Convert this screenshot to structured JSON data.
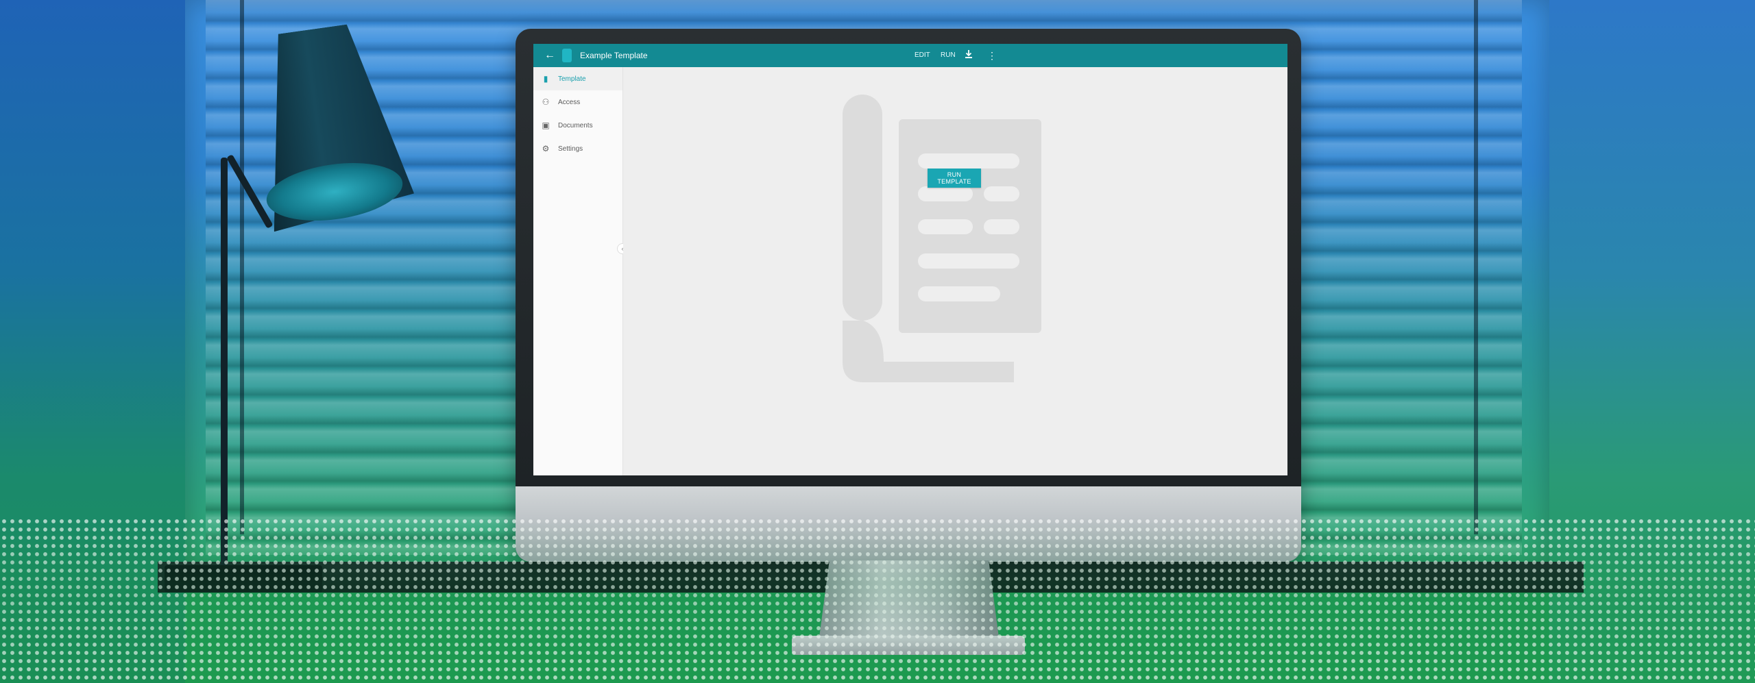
{
  "app": {
    "title": "Example Template"
  },
  "toolbar": {
    "back_icon": "arrow-left-icon",
    "logo_icon": "document-icon",
    "action_1_label": "EDIT",
    "action_2_label": "RUN",
    "download_icon": "download-icon",
    "more_icon": "more-vertical-icon"
  },
  "sidebar": {
    "items": [
      {
        "label": "Template",
        "icon": "document-icon",
        "active": true
      },
      {
        "label": "Access",
        "icon": "people-icon",
        "active": false
      },
      {
        "label": "Documents",
        "icon": "folder-icon",
        "active": false
      },
      {
        "label": "Settings",
        "icon": "gear-icon",
        "active": false
      }
    ],
    "collapse_icon": "chevron-left-icon"
  },
  "main": {
    "run_button_label": "RUN TEMPLATE"
  },
  "colors": {
    "accent": "#138a93",
    "button": "#1aa6b3",
    "screen_bg": "#eeeeee"
  }
}
